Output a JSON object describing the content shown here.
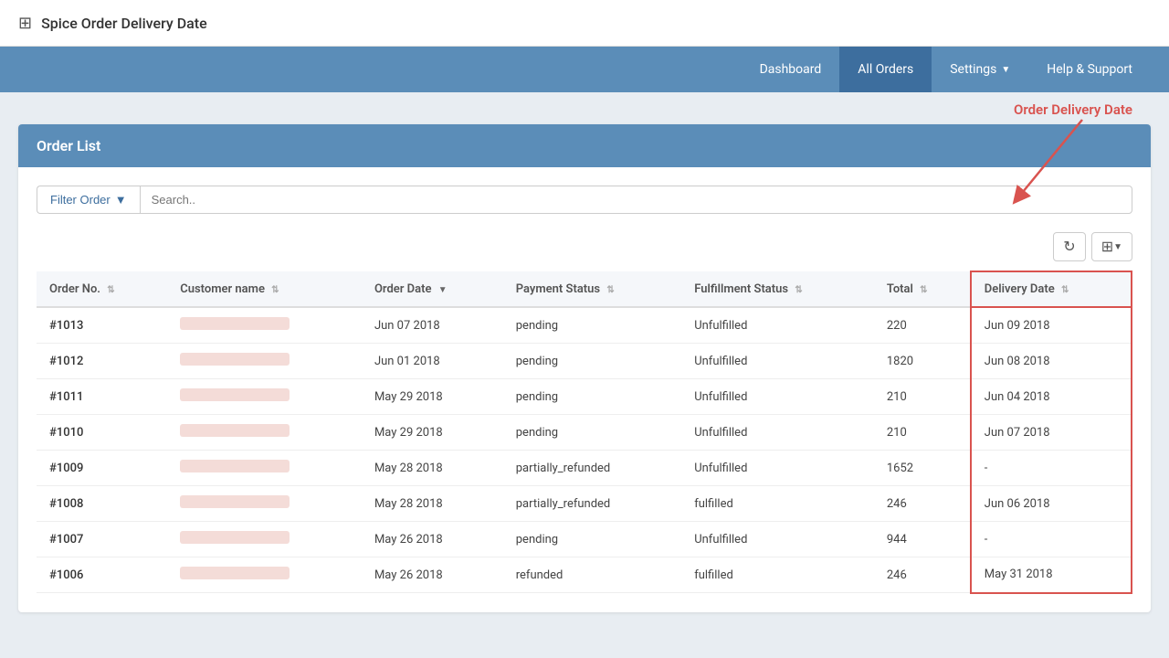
{
  "app": {
    "title": "Spice Order Delivery Date",
    "grid_icon": "⊞"
  },
  "nav": {
    "items": [
      {
        "label": "Dashboard",
        "active": false
      },
      {
        "label": "All Orders",
        "active": true
      },
      {
        "label": "Settings",
        "active": false,
        "dropdown": true
      },
      {
        "label": "Help & Support",
        "active": false
      }
    ]
  },
  "card": {
    "header": "Order List"
  },
  "filter": {
    "button_label": "Filter Order",
    "search_placeholder": "Search.."
  },
  "toolbar": {
    "refresh_icon": "↻",
    "view_icon": "⊞"
  },
  "annotation": {
    "label": "Order Delivery Date"
  },
  "table": {
    "columns": [
      {
        "key": "order_no",
        "label": "Order No.",
        "sortable": true
      },
      {
        "key": "customer_name",
        "label": "Customer name",
        "sortable": true
      },
      {
        "key": "order_date",
        "label": "Order Date",
        "sortable": true,
        "active": true
      },
      {
        "key": "payment_status",
        "label": "Payment Status",
        "sortable": true
      },
      {
        "key": "fulfillment_status",
        "label": "Fulfillment Status",
        "sortable": true
      },
      {
        "key": "total",
        "label": "Total",
        "sortable": true
      },
      {
        "key": "delivery_date",
        "label": "Delivery Date",
        "sortable": true,
        "highlight": true
      }
    ],
    "rows": [
      {
        "order_no": "#1013",
        "order_date": "Jun 07 2018",
        "payment_status": "pending",
        "fulfillment_status": "Unfulfilled",
        "total": "220",
        "delivery_date": "Jun 09 2018"
      },
      {
        "order_no": "#1012",
        "order_date": "Jun 01 2018",
        "payment_status": "pending",
        "fulfillment_status": "Unfulfilled",
        "total": "1820",
        "delivery_date": "Jun 08 2018"
      },
      {
        "order_no": "#1011",
        "order_date": "May 29 2018",
        "payment_status": "pending",
        "fulfillment_status": "Unfulfilled",
        "total": "210",
        "delivery_date": "Jun 04 2018"
      },
      {
        "order_no": "#1010",
        "order_date": "May 29 2018",
        "payment_status": "pending",
        "fulfillment_status": "Unfulfilled",
        "total": "210",
        "delivery_date": "Jun 07 2018"
      },
      {
        "order_no": "#1009",
        "order_date": "May 28 2018",
        "payment_status": "partially_refunded",
        "fulfillment_status": "Unfulfilled",
        "total": "1652",
        "delivery_date": "-"
      },
      {
        "order_no": "#1008",
        "order_date": "May 28 2018",
        "payment_status": "partially_refunded",
        "fulfillment_status": "fulfilled",
        "total": "246",
        "delivery_date": "Jun 06 2018"
      },
      {
        "order_no": "#1007",
        "order_date": "May 26 2018",
        "payment_status": "pending",
        "fulfillment_status": "Unfulfilled",
        "total": "944",
        "delivery_date": "-"
      },
      {
        "order_no": "#1006",
        "order_date": "May 26 2018",
        "payment_status": "refunded",
        "fulfillment_status": "fulfilled",
        "total": "246",
        "delivery_date": "May 31 2018"
      }
    ]
  }
}
